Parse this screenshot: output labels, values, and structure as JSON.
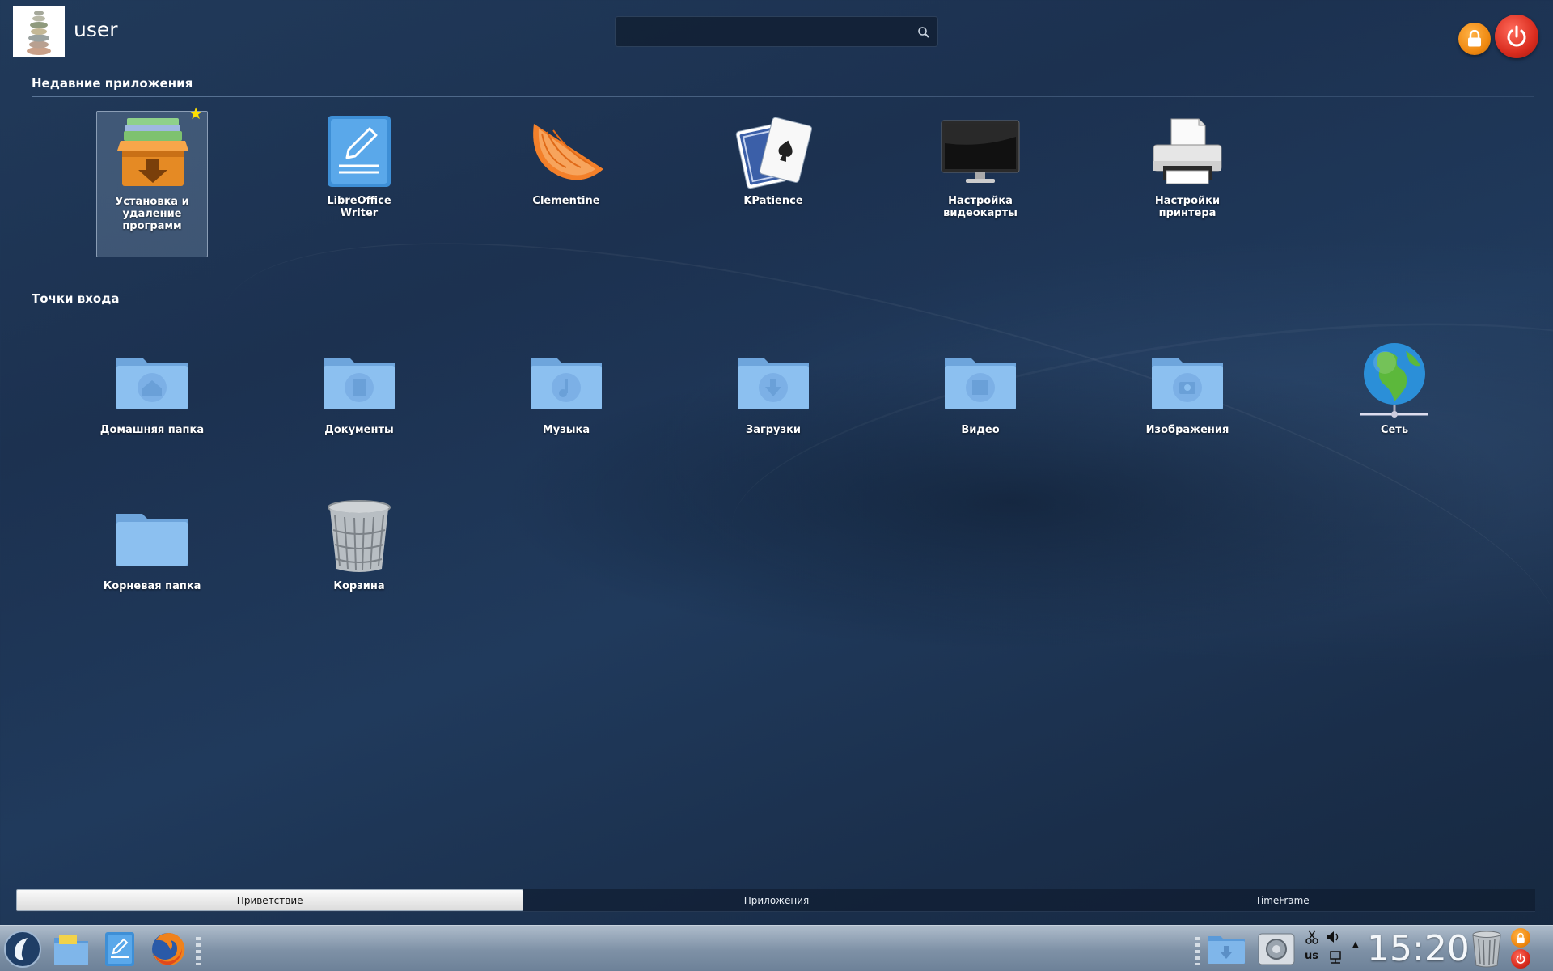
{
  "header": {
    "username": "user",
    "search_placeholder": "",
    "lock_icon": "lock-icon",
    "power_icon": "power-icon"
  },
  "recent": {
    "title": "Недавние приложения",
    "items": [
      {
        "label": "Установка и удаление программ",
        "icon": "package-installer-icon",
        "favorite": true,
        "selected": true
      },
      {
        "label": "LibreOffice Writer",
        "icon": "writer-icon"
      },
      {
        "label": "Clementine",
        "icon": "clementine-icon"
      },
      {
        "label": "KPatience",
        "icon": "playing-cards-icon"
      },
      {
        "label": "Настройка видеокарты",
        "icon": "monitor-icon"
      },
      {
        "label": "Настройки принтера",
        "icon": "printer-icon"
      }
    ]
  },
  "places": {
    "title": "Точки входа",
    "items": [
      {
        "label": "Домашняя папка",
        "icon": "home-folder-icon"
      },
      {
        "label": "Документы",
        "icon": "documents-folder-icon"
      },
      {
        "label": "Музыка",
        "icon": "music-folder-icon"
      },
      {
        "label": "Загрузки",
        "icon": "downloads-folder-icon"
      },
      {
        "label": "Видео",
        "icon": "video-folder-icon"
      },
      {
        "label": "Изображения",
        "icon": "pictures-folder-icon"
      },
      {
        "label": "Сеть",
        "icon": "network-globe-icon"
      },
      {
        "label": "Корневая папка",
        "icon": "root-folder-icon"
      },
      {
        "label": "Корзина",
        "icon": "trash-icon"
      }
    ]
  },
  "tabs": [
    {
      "label": "Приветствие",
      "active": true
    },
    {
      "label": "Приложения",
      "active": false
    },
    {
      "label": "TimeFrame",
      "active": false
    }
  ],
  "taskbar": {
    "clock": "15:20",
    "keyboard_layout": "us"
  },
  "colors": {
    "folder": "#7fb6ea",
    "accent_orange": "#f08a12",
    "accent_red": "#d92c1e",
    "favorite_star": "#ffe000"
  }
}
